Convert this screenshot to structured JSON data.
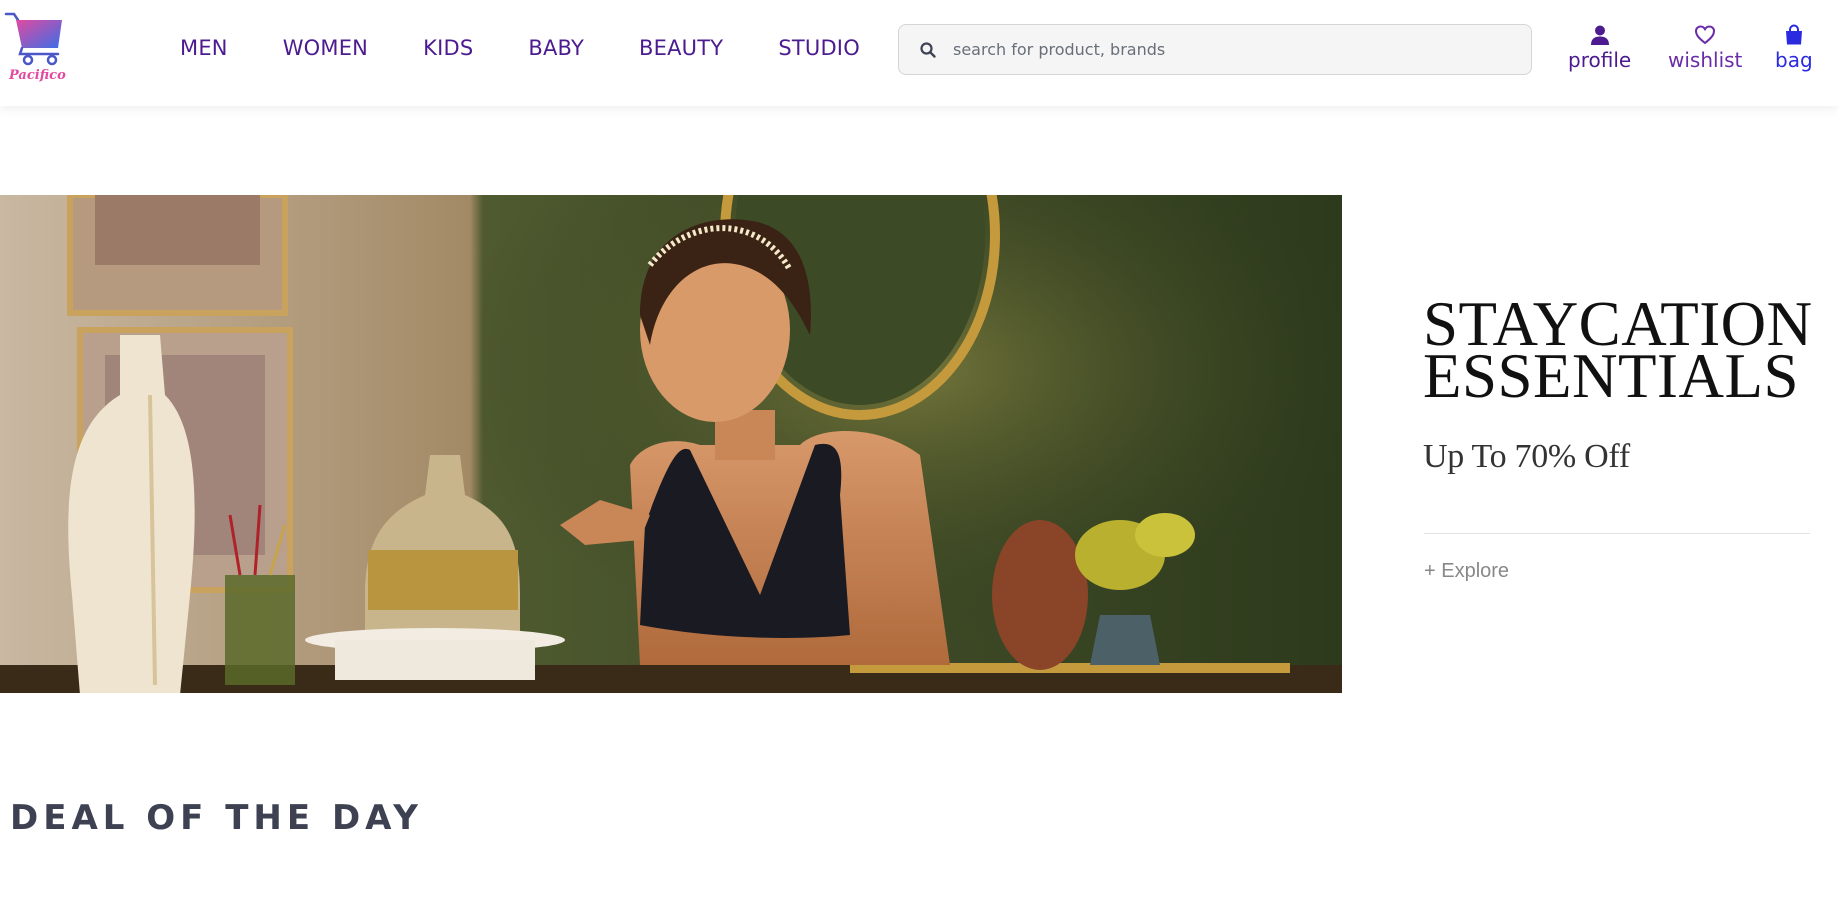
{
  "brand": {
    "name": "Pacifico"
  },
  "nav": {
    "items": [
      {
        "label": "MEN"
      },
      {
        "label": "WOMEN"
      },
      {
        "label": "KIDS"
      },
      {
        "label": "BABY"
      },
      {
        "label": "BEAUTY"
      },
      {
        "label": "STUDIO"
      }
    ]
  },
  "search": {
    "placeholder": "search for product, brands",
    "value": "",
    "icon": "search-icon"
  },
  "actions": {
    "profile": {
      "label": "profile",
      "icon": "user-icon"
    },
    "wishlist": {
      "label": "wishlist",
      "icon": "heart-icon"
    },
    "bag": {
      "label": "bag",
      "icon": "shopping-bag-icon"
    }
  },
  "hero": {
    "title_line1": "STAYCATION",
    "title_line2": "ESSENTIALS",
    "subtitle": "Up To 70% Off",
    "cta": "+ Explore"
  },
  "sections": {
    "deal_title": "DEAL OF THE DAY"
  },
  "colors": {
    "nav_text": "#4b1b8f",
    "wishlist": "#6a2ca8",
    "bag": "#2a2be0",
    "logo_gradient_start": "#e24aa0",
    "logo_gradient_end": "#3a6ee8"
  }
}
